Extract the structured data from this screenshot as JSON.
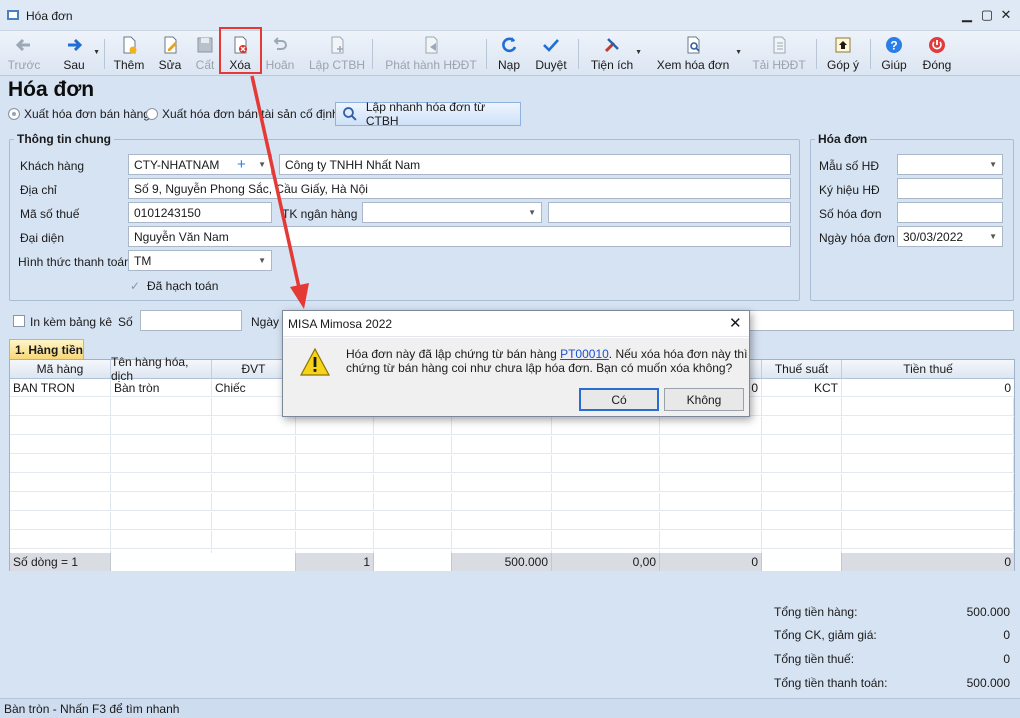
{
  "window": {
    "title": "Hóa đơn"
  },
  "toolbar": {
    "items": [
      {
        "label": "Trước",
        "icon": "arrow-left-icon"
      },
      {
        "label": "Sau",
        "icon": "arrow-right-icon"
      },
      {
        "label": "Thêm",
        "icon": "new-doc-icon"
      },
      {
        "label": "Sửa",
        "icon": "edit-icon"
      },
      {
        "label": "Cất",
        "icon": "save-icon"
      },
      {
        "label": "Xóa",
        "icon": "delete-icon"
      },
      {
        "label": "Hoãn",
        "icon": "undo-icon"
      },
      {
        "label": "Lập CTBH",
        "icon": "create-doc-icon"
      },
      {
        "label": "Phát hành HĐĐT",
        "icon": "publish-icon"
      },
      {
        "label": "Nạp",
        "icon": "refresh-icon"
      },
      {
        "label": "Duyệt",
        "icon": "check-icon"
      },
      {
        "label": "Tiện ích",
        "icon": "tools-icon"
      },
      {
        "label": "Xem hóa đơn",
        "icon": "preview-icon"
      },
      {
        "label": "Tải HĐĐT",
        "icon": "download-icon"
      },
      {
        "label": "Góp ý",
        "icon": "feedback-icon"
      },
      {
        "label": "Giúp",
        "icon": "help-icon"
      },
      {
        "label": "Đóng",
        "icon": "power-icon"
      }
    ]
  },
  "page": {
    "title": "Hóa đơn",
    "radio_sales": "Xuất hóa đơn bán hàng",
    "radio_assets": "Xuất hóa đơn bán tài sản cố định",
    "quick_button": "Lập nhanh hóa đơn từ CTBH"
  },
  "general": {
    "group_label": "Thông tin chung",
    "customer_label": "Khách hàng",
    "customer_code": "CTY-NHATNAM",
    "customer_name": "Công ty TNHH Nhất Nam",
    "address_label": "Địa chỉ",
    "address": "Số 9, Nguyễn Phong Sắc, Cầu Giấy, Hà Nội",
    "tax_label": "Mã số thuế",
    "tax_code": "0101243150",
    "bank_label": "TK ngân hàng",
    "bank_account": "",
    "bank_name": "",
    "rep_label": "Đại diện",
    "representative": "Nguyễn Văn Nam",
    "payment_label": "Hình thức thanh toán",
    "payment": "TM",
    "posted_label": "Đã hạch toán"
  },
  "invoice": {
    "group_label": "Hóa đơn",
    "template_label": "Mẫu số HĐ",
    "template": "",
    "symbol_label": "Ký hiệu HĐ",
    "symbol": "",
    "number_label": "Số hóa đơn",
    "number": "",
    "date_label": "Ngày hóa đơn",
    "date": "30/03/2022"
  },
  "attach": {
    "label": "In kèm bảng kê",
    "so_label": "Số",
    "ngay_label": "Ngày"
  },
  "grid": {
    "tab_label": "1. Hàng tiền",
    "headers": [
      "Mã hàng",
      "Tên hàng hóa, dịch",
      "ĐVT",
      "Thuế suất",
      "Tiền thuế"
    ],
    "row": {
      "ma_hang": "BAN TRON",
      "ten_hang": "Bàn tròn",
      "dvt": "Chiếc",
      "partial": "0",
      "thue_suat": "KCT",
      "tien_thue": "0"
    },
    "footer": {
      "so_dong": "Số dòng = 1",
      "qty": "1",
      "amount": "500.000",
      "discount": "0,00",
      "disc_amount": "0",
      "tax": "0"
    }
  },
  "totals": [
    {
      "label": "Tổng tiền hàng:",
      "value": "500.000"
    },
    {
      "label": "Tổng CK, giảm giá:",
      "value": "0"
    },
    {
      "label": "Tổng tiền thuế:",
      "value": "0"
    },
    {
      "label": "Tổng tiền thanh toán:",
      "value": "500.000"
    }
  ],
  "status": {
    "text": "Bàn tròn - Nhấn F3 để tìm nhanh"
  },
  "dialog": {
    "title": "MISA Mimosa 2022",
    "message_pre": "Hóa đơn này đã lập chứng từ bán hàng ",
    "message_link": "PT00010",
    "message_post": ". Nếu xóa hóa đơn này thì",
    "message_line2": "chứng từ bán hàng coi như chưa lập hóa đơn. Bạn có muốn xóa không?",
    "yes": "Có",
    "no": "Không"
  },
  "colors": {
    "annotation": "#e53935",
    "accent": "#2b6cd2"
  }
}
